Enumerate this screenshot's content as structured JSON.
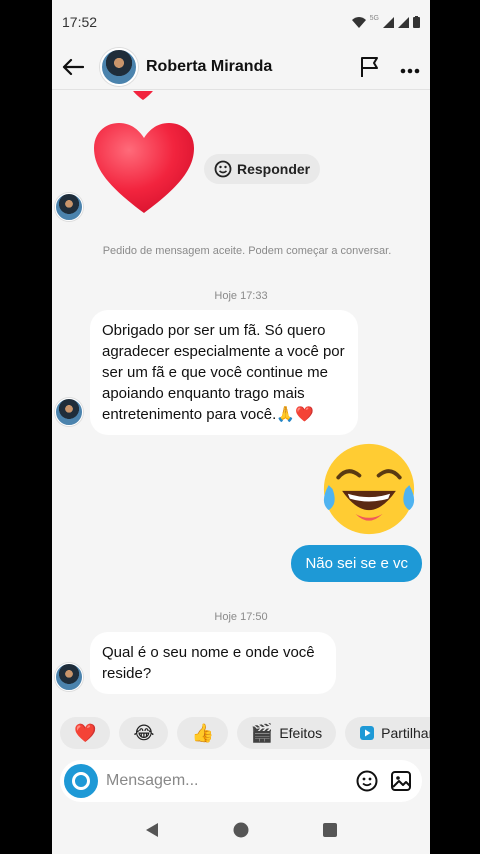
{
  "status_bar": {
    "time": "17:52",
    "network": "5G"
  },
  "header": {
    "name": "Roberta Miranda",
    "back_icon": "arrow-left-icon",
    "flag_icon": "flag-icon",
    "more_icon": "more-icon"
  },
  "chat": {
    "reply_label": "Responder",
    "system_message": "Pedido de mensagem aceite. Podem começar a conversar.",
    "timestamps": [
      "Hoje 17:33",
      "Hoje 17:50"
    ],
    "incoming_1": "Obrigado por ser um fã. Só quero agradecer especialmente a você por ser um fã e que você continue me apoiando enquanto trago mais entretenimento para você.🙏❤️",
    "outgoing_1": "Não sei se e vc",
    "incoming_2": "Qual é o seu nome e onde você reside?"
  },
  "quick_reactions": {
    "heart": "❤️",
    "laugh": "😂",
    "thumbs": "👍",
    "effects_icon": "🎬",
    "effects_label": "Efeitos",
    "share_label": "Partilhar pub"
  },
  "composer": {
    "placeholder": "Mensagem..."
  },
  "colors": {
    "accent": "#1e99d6",
    "background": "#f5f5f5",
    "bubble_in": "#ffffff",
    "heart": "#f2243e"
  }
}
